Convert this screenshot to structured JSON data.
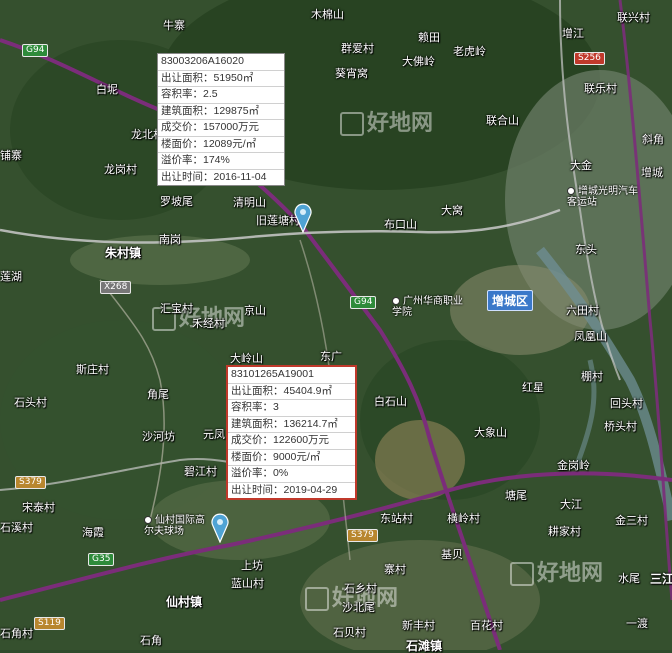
{
  "map": {
    "places": [
      {
        "id": "niuzhai",
        "text": "牛寨"
      },
      {
        "id": "mumianshan",
        "text": "木棉山"
      },
      {
        "id": "qunaicun",
        "text": "群爱村"
      },
      {
        "id": "kuixiuwo",
        "text": "葵宵窝"
      },
      {
        "id": "laifu",
        "text": "赖田"
      },
      {
        "id": "dameiling",
        "text": "大佛岭"
      },
      {
        "id": "laoqiling",
        "text": "老虎岭"
      },
      {
        "id": "lianxing",
        "text": "联兴村"
      },
      {
        "id": "lianheshan",
        "text": "联合山"
      },
      {
        "id": "dagou",
        "text": "大岗"
      },
      {
        "id": "baiqiao",
        "text": "白坭"
      },
      {
        "id": "lianxin",
        "text": "联兴村"
      },
      {
        "id": "longbei",
        "text": "龙北村"
      },
      {
        "id": "bozhai",
        "text": "铺寨"
      },
      {
        "id": "longgang",
        "text": "龙岗村"
      },
      {
        "id": "luobowei",
        "text": "罗坡尾"
      },
      {
        "id": "qingmingshan",
        "text": "清明山"
      },
      {
        "id": "jiuliantang",
        "text": "旧莲塘村"
      },
      {
        "id": "buwushan",
        "text": "布口山"
      },
      {
        "id": "dakao",
        "text": "大窝"
      },
      {
        "id": "nangang",
        "text": "南岗"
      },
      {
        "id": "zhucunzhen",
        "text": "朱村镇"
      },
      {
        "id": "lianhu",
        "text": "莲湖"
      },
      {
        "id": "huibaocun",
        "text": "汇宝村"
      },
      {
        "id": "mujing",
        "text": "禾经村"
      },
      {
        "id": "jingshan",
        "text": "京山"
      },
      {
        "id": "dongguang",
        "text": "东广"
      },
      {
        "id": "dalingshan",
        "text": "大岭山"
      },
      {
        "id": "sizhuang",
        "text": "斯庄村"
      },
      {
        "id": "shitoucun",
        "text": "石头村"
      },
      {
        "id": "jiaowei",
        "text": "角尾"
      },
      {
        "id": "shaheyuan",
        "text": "沙河坊"
      },
      {
        "id": "baishishan",
        "text": "白石山"
      },
      {
        "id": "damoxian",
        "text": "大象山"
      },
      {
        "id": "hongxing",
        "text": "红星"
      },
      {
        "id": "bijiangcun",
        "text": "碧江村"
      },
      {
        "id": "yuanfeng",
        "text": "元凤"
      },
      {
        "id": "songmuo",
        "text": "宋泰村"
      },
      {
        "id": "shixian",
        "text": "石溪村"
      },
      {
        "id": "haixia",
        "text": "海霞"
      },
      {
        "id": "dongzhan",
        "text": "东站村"
      },
      {
        "id": "hengling",
        "text": "横岭村"
      },
      {
        "id": "jiabei",
        "text": "基贝"
      },
      {
        "id": "shangfang",
        "text": "上坊"
      },
      {
        "id": "lanshan",
        "text": "蓝山村"
      },
      {
        "id": "xiancunzhen",
        "text": "仙村镇"
      },
      {
        "id": "zhaicun",
        "text": "寨村"
      },
      {
        "id": "shixiang",
        "text": "石乡村"
      },
      {
        "id": "shabeiwei",
        "text": "沙北尾"
      },
      {
        "id": "shijiao",
        "text": "石角"
      },
      {
        "id": "tangwei",
        "text": "塘尾"
      },
      {
        "id": "shibei",
        "text": "石贝村"
      },
      {
        "id": "xinfeng",
        "text": "新丰村"
      },
      {
        "id": "baihua",
        "text": "百花村"
      },
      {
        "id": "shitang",
        "text": "石滩镇"
      },
      {
        "id": "huitu",
        "text": "回头村"
      },
      {
        "id": "qiaotou",
        "text": "桥头村"
      },
      {
        "id": "dajiang",
        "text": "大江"
      },
      {
        "id": "jinsancun",
        "text": "金三村"
      },
      {
        "id": "gengjiacun",
        "text": "耕家村"
      },
      {
        "id": "jingangling",
        "text": "金岗岭"
      },
      {
        "id": "pengcun",
        "text": "棚村"
      },
      {
        "id": "shuiwei",
        "text": "水尾"
      },
      {
        "id": "yiduo",
        "text": "一渡"
      },
      {
        "id": "zengcheng",
        "text": "增城"
      },
      {
        "id": "dongtou",
        "text": "东头"
      },
      {
        "id": "fenghuang",
        "text": "凤凰山"
      },
      {
        "id": "liutian",
        "text": "六田村"
      },
      {
        "id": "xiejiao",
        "text": "斜角"
      },
      {
        "id": "sanjiang",
        "text": "三江"
      },
      {
        "id": "lianlecun",
        "text": "联乐村"
      },
      {
        "id": "dajin",
        "text": "大金"
      },
      {
        "id": "zengjiang",
        "text": "增江"
      },
      {
        "id": "shijiao2",
        "text": "石角村"
      }
    ],
    "district": "增城区",
    "school": "广州华商职业学院",
    "golf": "仙村国际高尔夫球场",
    "station": "增城光明汽车客运站",
    "shields": {
      "g94a": "G94",
      "g94b": "G94",
      "x268": "X268",
      "s256": "S256",
      "s379a": "S379",
      "s379b": "S379",
      "g35": "G35",
      "s119": "S119"
    },
    "watermark": "好地网"
  },
  "parcels": [
    {
      "id": "83003206A16020",
      "rows": [
        "出让面积：51950㎡",
        "容积率：2.5",
        "建筑面积：129875㎡",
        "成交价：157000万元",
        "楼面价：12089元/㎡",
        "溢价率：174%",
        "出让时间：2016-11-04"
      ]
    },
    {
      "id": "83101265A19001",
      "rows": [
        "出让面积：45404.9㎡",
        "容积率：3",
        "建筑面积：136214.7㎡",
        "成交价：122600万元",
        "楼面价：9000元/㎡",
        "溢价率：0%",
        "出让时间：2019-04-29"
      ]
    }
  ],
  "colors": {
    "highway": "#7b2d7a",
    "highlight_border": "#c0392b",
    "district_bg": "#3a78c9"
  }
}
